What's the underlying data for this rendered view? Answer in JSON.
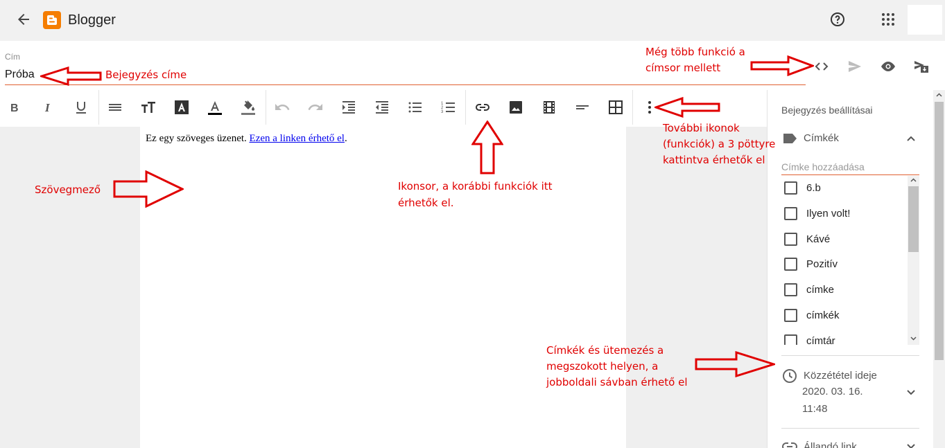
{
  "app": {
    "name": "Blogger"
  },
  "post": {
    "title_label": "Cím",
    "title_value": "Próba",
    "body_text": "Ez egy szöveges üzenet. ",
    "body_link": "Ezen a linken érhető el",
    "body_end": "."
  },
  "sidebar": {
    "title": "Bejegyzés beállításai",
    "labels_heading": "Címkék",
    "tag_placeholder": "Címke hozzáadása",
    "tags": [
      "6.b",
      "Ilyen volt!",
      "Kávé",
      "Pozitív",
      "címke",
      "címkék",
      "címtár"
    ],
    "publish_heading": "Közzététel ideje",
    "publish_date": "2020. 03. 16.",
    "publish_time": "11:48",
    "permalink_heading": "Állandó link"
  },
  "annotations": {
    "title_note": "Bejegyzés címe",
    "more_functions_1": "Még több funkció a",
    "more_functions_2": "címsor mellett",
    "more_icons_1": "További ikonok",
    "more_icons_2": "(funkciók) a 3 pöttyre",
    "more_icons_3": "kattintva érhetők el",
    "textfield": "Szövegmező",
    "toolbar_1": "Ikonsor, a korábbi funkciók itt",
    "toolbar_2": "érhetők el.",
    "sidebar_1": "Címkék és ütemezés a",
    "sidebar_2": "megszokott helyen, a",
    "sidebar_3": "jobboldali sávban érhető el"
  },
  "colors": {
    "accent": "#e06030",
    "brand": "#f57d00",
    "annotation": "#e00000"
  },
  "icons": [
    "back-arrow-icon",
    "blogger-logo-icon",
    "help-icon",
    "apps-grid-icon",
    "html-code-icon",
    "publish-icon",
    "preview-icon",
    "update-icon",
    "bold-icon",
    "italic-icon",
    "underline-icon",
    "paragraph-icon",
    "font-size-icon",
    "text-color-icon",
    "highlight-color-icon",
    "undo-icon",
    "redo-icon",
    "indent-icon",
    "outdent-icon",
    "bulleted-list-icon",
    "numbered-list-icon",
    "link-icon",
    "image-icon",
    "video-icon",
    "align-icon",
    "table-icon",
    "more-vert-icon",
    "label-icon",
    "clock-icon",
    "permalink-icon"
  ]
}
